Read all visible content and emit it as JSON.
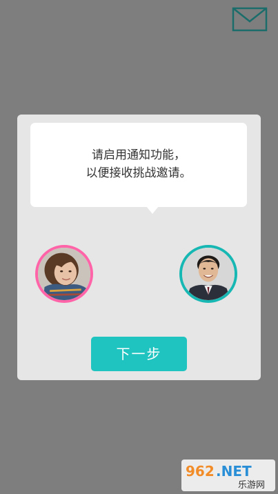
{
  "header": {
    "mail_icon": "mail-icon"
  },
  "dialog": {
    "message_lines": [
      "请启用通知功能，",
      "以便接收挑战邀请。"
    ],
    "avatars": [
      {
        "name": "female-avatar",
        "ring_color": "#ff64a8"
      },
      {
        "name": "male-avatar",
        "ring_color": "#17b7b3"
      }
    ],
    "next_button_label": "下一步"
  },
  "colors": {
    "background": "#7e7e7e",
    "card": "#e6e6e6",
    "accent": "#1fc3bf",
    "icon_teal": "#1a6d6a"
  },
  "watermark": {
    "text": "962.NET 乐游网"
  }
}
